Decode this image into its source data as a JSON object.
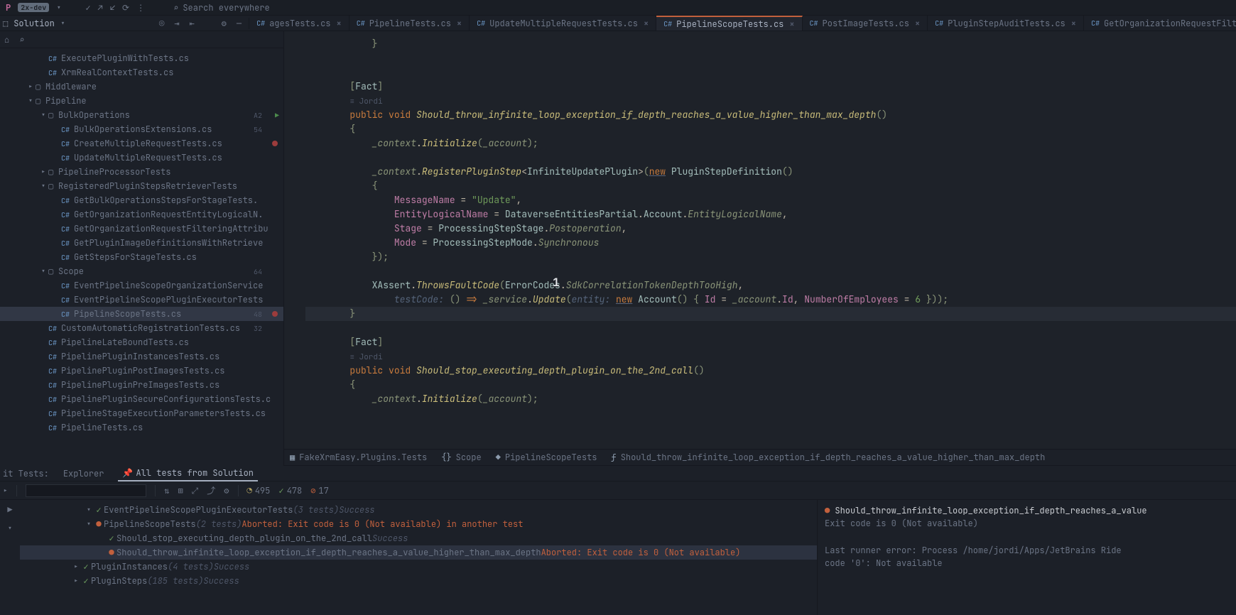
{
  "topbar": {
    "project": "P",
    "branch": "2x-dev",
    "search_placeholder": "Search everywhere"
  },
  "solution_header": "Solution",
  "tabs": [
    {
      "lang": "C#",
      "name": "agesTests.cs",
      "active": false,
      "trunc": true
    },
    {
      "lang": "C#",
      "name": "PipelineTests.cs",
      "active": false
    },
    {
      "lang": "C#",
      "name": "UpdateMultipleRequestTests.cs",
      "active": false
    },
    {
      "lang": "C#",
      "name": "PipelineScopeTests.cs",
      "active": true
    },
    {
      "lang": "C#",
      "name": "PostImageTests.cs",
      "active": false
    },
    {
      "lang": "C#",
      "name": "PluginStepAuditTests.cs",
      "active": false
    },
    {
      "lang": "C#",
      "name": "GetOrganizationRequestFilter",
      "active": false,
      "trunc": true
    }
  ],
  "tree": [
    {
      "d": 3,
      "t": "file",
      "lang": "C#",
      "label": "ExecutePluginWithTests.cs"
    },
    {
      "d": 3,
      "t": "file",
      "lang": "C#",
      "label": "XrmRealContextTests.cs"
    },
    {
      "d": 2,
      "t": "folder",
      "arrow": ">",
      "label": "Middleware"
    },
    {
      "d": 2,
      "t": "folder",
      "arrow": "v",
      "label": "Pipeline"
    },
    {
      "d": 3,
      "t": "folder",
      "arrow": "v",
      "label": "BulkOperations",
      "gutter": "A2",
      "run": true
    },
    {
      "d": 4,
      "t": "file",
      "lang": "C#",
      "label": "BulkOperationsExtensions.cs",
      "gutter": "54"
    },
    {
      "d": 4,
      "t": "file",
      "lang": "C#",
      "label": "CreateMultipleRequestTests.cs",
      "bp": true
    },
    {
      "d": 4,
      "t": "file",
      "lang": "C#",
      "label": "UpdateMultipleRequestTests.cs"
    },
    {
      "d": 3,
      "t": "folder",
      "arrow": ">",
      "label": "PipelineProcessorTests"
    },
    {
      "d": 3,
      "t": "folder",
      "arrow": "v",
      "label": "RegisteredPluginStepsRetrieverTests"
    },
    {
      "d": 4,
      "t": "file",
      "lang": "C#",
      "label": "GetBulkOperationsStepsForStageTests."
    },
    {
      "d": 4,
      "t": "file",
      "lang": "C#",
      "label": "GetOrganizationRequestEntityLogicalN."
    },
    {
      "d": 4,
      "t": "file",
      "lang": "C#",
      "label": "GetOrganizationRequestFilteringAttribu"
    },
    {
      "d": 4,
      "t": "file",
      "lang": "C#",
      "label": "GetPluginImageDefinitionsWithRetrieve"
    },
    {
      "d": 4,
      "t": "file",
      "lang": "C#",
      "label": "GetStepsForStageTests.cs"
    },
    {
      "d": 3,
      "t": "folder",
      "arrow": "v",
      "label": "Scope",
      "gutter": "64"
    },
    {
      "d": 4,
      "t": "file",
      "lang": "C#",
      "label": "EventPipelineScopeOrganizationService"
    },
    {
      "d": 4,
      "t": "file",
      "lang": "C#",
      "label": "EventPipelineScopePluginExecutorTests"
    },
    {
      "d": 4,
      "t": "file",
      "lang": "C#",
      "label": "PipelineScopeTests.cs",
      "sel": true,
      "gutter": "48",
      "bp": true
    },
    {
      "d": 3,
      "t": "file",
      "lang": "C#",
      "label": "CustomAutomaticRegistrationTests.cs",
      "gutter": "32"
    },
    {
      "d": 3,
      "t": "file",
      "lang": "C#",
      "label": "PipelineLateBoundTests.cs"
    },
    {
      "d": 3,
      "t": "file",
      "lang": "C#",
      "label": "PipelinePluginInstancesTests.cs"
    },
    {
      "d": 3,
      "t": "file",
      "lang": "C#",
      "label": "PipelinePluginPostImagesTests.cs"
    },
    {
      "d": 3,
      "t": "file",
      "lang": "C#",
      "label": "PipelinePluginPreImagesTests.cs"
    },
    {
      "d": 3,
      "t": "file",
      "lang": "C#",
      "label": "PipelinePluginSecureConfigurationsTests.c"
    },
    {
      "d": 3,
      "t": "file",
      "lang": "C#",
      "label": "PipelineStageExecutionParametersTests.cs"
    },
    {
      "d": 3,
      "t": "file",
      "lang": "C#",
      "label": "PipelineTests.cs"
    }
  ],
  "code": {
    "author": "Jordi",
    "lines": [
      {
        "html": "            <span class='paren'>}</span>"
      },
      {
        "html": ""
      },
      {
        "html": ""
      },
      {
        "html": "        <span class='paren'>[</span><span class='type'>Fact</span><span class='paren'>]</span>"
      },
      {
        "html": "        <span class='author'>≡ Jordi</span>"
      },
      {
        "html": "        <span class='kw'>public</span> <span class='kw'>void</span> <span class='fn'>Should_throw_infinite_loop_exception_if_depth_reaches_a_value_higher_than_max_depth</span><span class='paren'>()</span>"
      },
      {
        "html": "        <span class='paren'>{</span>"
      },
      {
        "html": "            <span class='param'>_context</span>.<span class='fn'>Initialize</span><span class='paren'>(</span><span class='param'>_account</span><span class='paren'>);</span>"
      },
      {
        "html": ""
      },
      {
        "html": "            <span class='param'>_context</span>.<span class='fn'>RegisterPluginStep</span>&lt;<span class='type'>InfiniteUpdatePlugin</span>&gt;<span class='paren'>(</span><span class='kw underline'>new</span> <span class='type'>PluginStepDefinition</span><span class='paren'>()</span>"
      },
      {
        "html": "            <span class='paren'>{</span>"
      },
      {
        "html": "                <span class='field'>MessageName</span> = <span class='str'>\"Update\"</span>,"
      },
      {
        "html": "                <span class='field'>EntityLogicalName</span> = <span class='type'>DataverseEntitiesPartial</span>.<span class='type'>Account</span>.<span class='param'>EntityLogicalName</span>,"
      },
      {
        "html": "                <span class='field'>Stage</span> = <span class='type'>ProcessingStepStage</span>.<span class='param'>Postoperation</span>,"
      },
      {
        "html": "                <span class='field'>Mode</span> = <span class='type'>ProcessingStepMode</span>.<span class='param'>Synchronous</span>"
      },
      {
        "html": "            <span class='paren'>});</span>"
      },
      {
        "html": ""
      },
      {
        "html": "            <span class='type'>XAssert</span>.<span class='fn'>ThrowsFaultCode</span><span class='paren'>(</span><span class='type'>ErrorCodes</span>.<span class='param'>SdkCorrelationTokenDepthTooHigh</span>,"
      },
      {
        "html": "                <span class='dim'>testCode:</span> <span class='paren'>()</span> <span class='kw'>=&gt;</span> <span class='param'>_service</span>.<span class='fn'>Update</span><span class='paren'>(</span><span class='dim'>entity:</span> <span class='kw underline'>new</span> <span class='type'>Account</span><span class='paren'>() {</span> <span class='field'>Id</span> = <span class='param'>_account</span>.<span class='field'>Id</span>, <span class='field'>NumberOfEmployees</span> = <span class='num'>6</span> <span class='paren'>}));</span>"
      },
      {
        "html": "        <span class='paren'>}</span>",
        "hl": true
      },
      {
        "html": ""
      },
      {
        "html": "        <span class='paren'>[</span><span class='type'>Fact</span><span class='paren'>]</span>"
      },
      {
        "html": "        <span class='author'>≡ Jordi</span>"
      },
      {
        "html": "        <span class='kw'>public</span> <span class='kw'>void</span> <span class='fn'>Should_stop_executing_depth_plugin_on_the_2nd_call</span><span class='paren'>()</span>"
      },
      {
        "html": "        <span class='paren'>{</span>"
      },
      {
        "html": "            <span class='param'>_context</span>.<span class='fn'>Initialize</span><span class='paren'>(</span><span class='param'>_account</span><span class='paren'>);</span>"
      }
    ]
  },
  "crumbs": [
    {
      "ico": "ns",
      "label": "FakeXrmEasy.Plugins.Tests"
    },
    {
      "ico": "{}",
      "label": "Scope"
    },
    {
      "ico": "cls",
      "label": "PipelineScopeTests"
    },
    {
      "ico": "m",
      "label": "Should_throw_infinite_loop_exception_if_depth_reaches_a_value_higher_than_max_depth"
    }
  ],
  "tests": {
    "header_left": "it Tests:",
    "tabs": [
      "Explorer",
      "All tests from Solution"
    ],
    "active_tab": 1,
    "counts": {
      "total": "495",
      "passed": "478",
      "failed": "17"
    },
    "tree": [
      {
        "d": 5,
        "arrow": "v",
        "status": "ok",
        "label": "EventPipelineScopePluginExecutorTests",
        "meta": "(3 tests)",
        "result": "Success"
      },
      {
        "d": 5,
        "arrow": "v",
        "status": "fail",
        "label": "PipelineScopeTests",
        "meta": "(2 tests)",
        "result": "Aborted: Exit code is 0 (Not available) in another test",
        "err": true
      },
      {
        "d": 6,
        "status": "ok",
        "label": "Should_stop_executing_depth_plugin_on_the_2nd_call",
        "result": "Success"
      },
      {
        "d": 6,
        "status": "fail",
        "label": "Should_throw_infinite_loop_exception_if_depth_reaches_a_value_higher_than_max_depth",
        "result": "Aborted: Exit code is 0 (Not available)",
        "err": true,
        "sel": true
      },
      {
        "d": 4,
        "arrow": ">",
        "status": "ok",
        "label": "PluginInstances",
        "meta": "(4 tests)",
        "result": "Success"
      },
      {
        "d": 4,
        "arrow": ">",
        "status": "ok",
        "label": "PluginSteps",
        "meta": "(185 tests)",
        "result": "Success"
      }
    ],
    "output": {
      "title": "Should_throw_infinite_loop_exception_if_depth_reaches_a_value",
      "line1": "Exit code is 0 (Not available)",
      "line2": "Last runner error: Process /home/jordi/Apps/JetBrains Ride",
      "line3": " code '0': Not available"
    }
  },
  "cursor_overlay": "1"
}
